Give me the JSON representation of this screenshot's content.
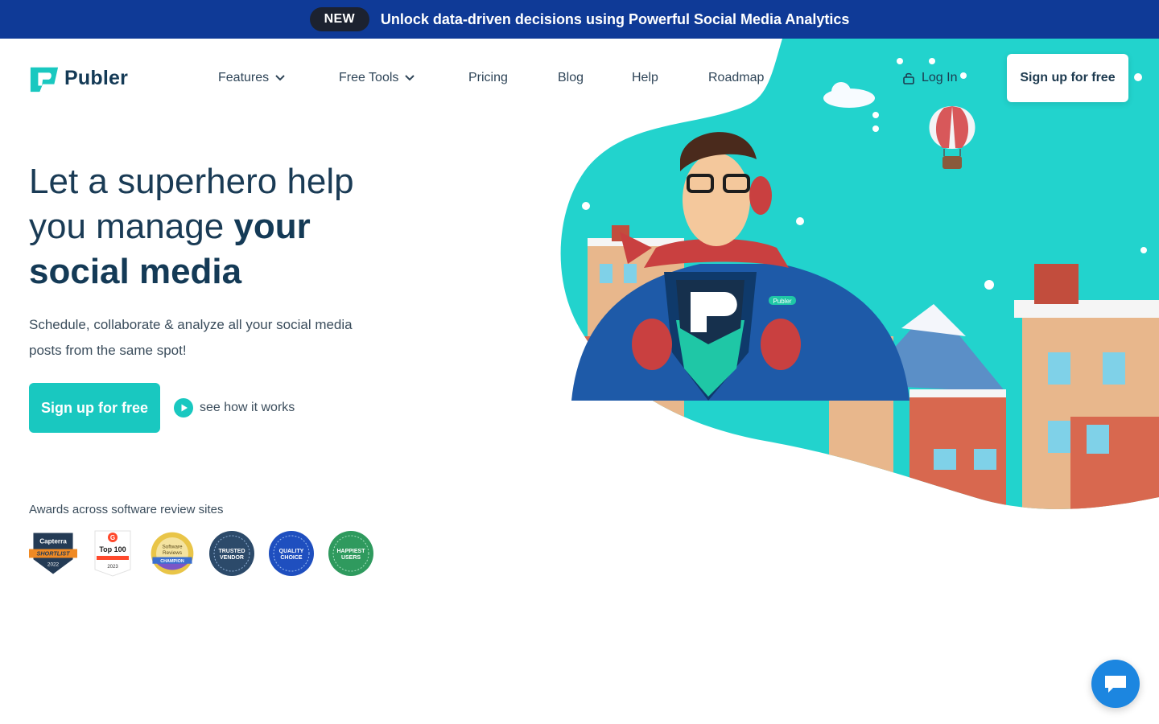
{
  "banner": {
    "badge": "NEW",
    "message": "Unlock data-driven decisions using Powerful Social Media Analytics"
  },
  "brand": {
    "name": "Publer",
    "accent": "#19c8c0",
    "banner_bg": "#0f3a97"
  },
  "nav": {
    "features": "Features",
    "free_tools": "Free Tools",
    "pricing": "Pricing",
    "blog": "Blog",
    "help": "Help",
    "roadmap": "Roadmap",
    "login": "Log In",
    "signup": "Sign up for free"
  },
  "hero": {
    "headline_part1": "Let a superhero help you manage ",
    "headline_bold": "your social media",
    "subtitle": "Schedule, collaborate & analyze all your social media posts from the same spot!",
    "cta": "Sign up for free",
    "see_how": "see how it works"
  },
  "awards": {
    "title": "Awards across software review sites",
    "items": [
      {
        "name": "capterra-shortlist",
        "lines": [
          "Capterra",
          "SHORTLIST",
          "2022"
        ]
      },
      {
        "name": "g2-top-100",
        "lines": [
          "G",
          "Top 100",
          "2023"
        ]
      },
      {
        "name": "software-reviews-champion",
        "lines": [
          "Software",
          "Reviews",
          "CHAMPION"
        ]
      },
      {
        "name": "trusted-vendor",
        "lines": [
          "TRUSTED",
          "VENDOR"
        ]
      },
      {
        "name": "quality-choice",
        "lines": [
          "QUALITY",
          "CHOICE"
        ]
      },
      {
        "name": "happiest-users",
        "lines": [
          "HAPPIEST",
          "USERS"
        ]
      }
    ]
  },
  "illustration": {
    "hero_badge": "Publer"
  },
  "icons": {
    "lock": "lock-icon",
    "play": "play-icon",
    "chat": "chat-icon",
    "chevron": "chevron-down-icon"
  }
}
